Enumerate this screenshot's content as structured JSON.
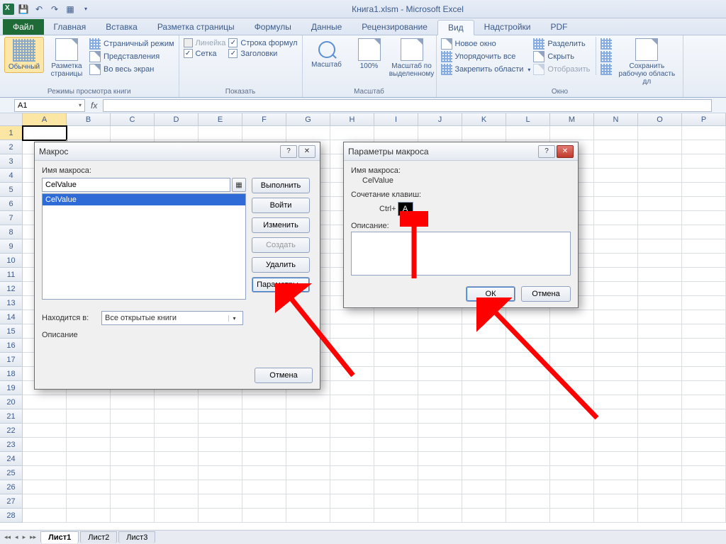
{
  "title": "Книга1.xlsm  -  Microsoft Excel",
  "tabs": {
    "file": "Файл",
    "list": [
      "Главная",
      "Вставка",
      "Разметка страницы",
      "Формулы",
      "Данные",
      "Рецензирование",
      "Вид",
      "Надстройки",
      "PDF"
    ],
    "active": "Вид"
  },
  "ribbon": {
    "views": {
      "normal": "Обычный",
      "page_layout": "Разметка\nстраницы",
      "page_break": "Страничный режим",
      "custom": "Представления",
      "full": "Во весь экран",
      "group": "Режимы просмотра книги"
    },
    "show": {
      "ruler": "Линейка",
      "formula_bar": "Строка формул",
      "grid": "Сетка",
      "headings": "Заголовки",
      "group": "Показать"
    },
    "zoom": {
      "zoom": "Масштаб",
      "z100": "100%",
      "zsel": "Масштаб по\nвыделенному",
      "group": "Масштаб"
    },
    "window": {
      "neww": "Новое окно",
      "arrange": "Упорядочить все",
      "freeze": "Закрепить области",
      "split": "Разделить",
      "hide": "Скрыть",
      "unhide": "Отобразить",
      "group": "Окно",
      "save_ws": "Сохранить\nрабочую область дл"
    }
  },
  "namebox": "A1",
  "columns": [
    "A",
    "B",
    "C",
    "D",
    "E",
    "F",
    "G",
    "H",
    "I",
    "J",
    "K",
    "L",
    "M",
    "N",
    "O",
    "P"
  ],
  "rows_count": 28,
  "sheets": [
    "Лист1",
    "Лист2",
    "Лист3"
  ],
  "macro_dialog": {
    "title": "Макрос",
    "name_label": "Имя макроса:",
    "name_value": "CelValue",
    "list": [
      "CelValue"
    ],
    "in_label": "Находится в:",
    "in_value": "Все открытые книги",
    "desc_label": "Описание",
    "buttons": {
      "run": "Выполнить",
      "step": "Войти",
      "edit": "Изменить",
      "create": "Создать",
      "delete": "Удалить",
      "options": "Параметры...",
      "cancel": "Отмена"
    }
  },
  "options_dialog": {
    "title": "Параметры макроса",
    "name_label": "Имя макроса:",
    "name_value": "CelValue",
    "shortcut_label": "Сочетание клавиш:",
    "ctrl": "Ctrl+",
    "key": "A",
    "desc_label": "Описание:",
    "ok": "ОК",
    "cancel": "Отмена"
  }
}
